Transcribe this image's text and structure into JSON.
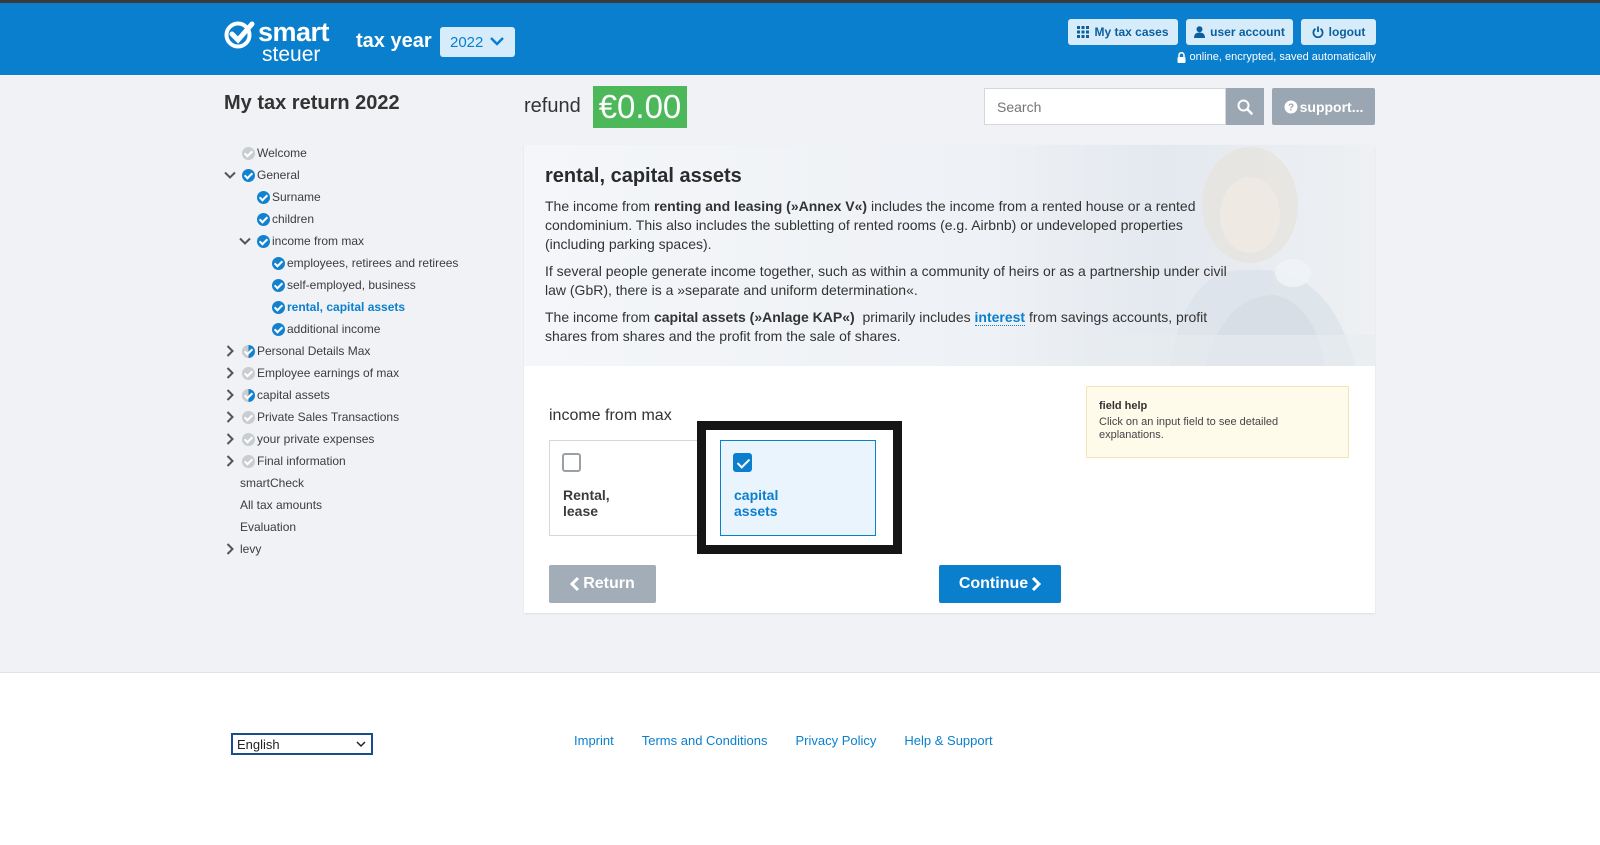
{
  "header": {
    "logo_line1": "smart",
    "logo_line2": "steuer",
    "tax_year_label": "tax year",
    "tax_year_value": "2022",
    "my_tax_cases": "My tax cases",
    "user_account": "user account",
    "logout": "logout",
    "status": "online, encrypted, saved automatically"
  },
  "page_title": "My tax return 2022",
  "refund": {
    "label": "refund",
    "value": "€0.00"
  },
  "search": {
    "placeholder": "Search"
  },
  "support_label": "support...",
  "nav": {
    "items": [
      {
        "label": "Welcome",
        "status": "todo"
      },
      {
        "label": "General",
        "status": "done"
      },
      {
        "label": "Surname",
        "status": "done"
      },
      {
        "label": "children",
        "status": "done"
      },
      {
        "label": "income from max",
        "status": "done"
      },
      {
        "label": "employees, retirees and retirees",
        "status": "done"
      },
      {
        "label": "self-employed, business",
        "status": "done"
      },
      {
        "label": "rental, capital assets",
        "status": "done"
      },
      {
        "label": "additional income",
        "status": "done"
      },
      {
        "label": "Personal Details Max",
        "status": "part"
      },
      {
        "label": "Employee earnings of max",
        "status": "todo"
      },
      {
        "label": "capital assets",
        "status": "part"
      },
      {
        "label": "Private Sales Transactions",
        "status": "todo"
      },
      {
        "label": "your private expenses",
        "status": "todo"
      },
      {
        "label": "Final information",
        "status": "todo"
      },
      {
        "label": "smartCheck",
        "status": "none"
      },
      {
        "label": "All tax amounts",
        "status": "none"
      },
      {
        "label": "Evaluation",
        "status": "none"
      },
      {
        "label": "levy",
        "status": "none"
      }
    ]
  },
  "card": {
    "title": "rental, capital assets",
    "p1_a": "The income from ",
    "p1_b": "renting and leasing (»Annex V«)",
    "p1_c": " includes the income from a rented house or a rented condominium. This also includes the subletting of rented rooms (e.g. Airbnb) or undeveloped properties (including parking spaces).",
    "p2": "If several people generate income together, such as within a community of heirs or as a partnership under civil law (GbR), there is a »separate and uniform determination«.",
    "p3_a": "The income from ",
    "p3_b": "capital assets (»Anlage KAP«)",
    "p3_c": "  primarily includes ",
    "p3_link": "interest",
    "p3_d": " from savings accounts, profit shares from shares and the profit from the sale of shares.",
    "section_label": "income from max",
    "options": [
      {
        "label": "Rental,\nlease",
        "checked": false
      },
      {
        "label": "capital\nassets",
        "checked": true
      }
    ],
    "return_label": "Return",
    "continue_label": "Continue",
    "field_help_title": "field help",
    "field_help_text": "Click on an input field to see detailed explanations."
  },
  "footer": {
    "language": "English",
    "links": [
      "Imprint",
      "Terms and Conditions",
      "Privacy Policy",
      "Help & Support"
    ]
  },
  "colors": {
    "brand_blue": "#0a7fce",
    "refund_green": "#4cb85a"
  }
}
